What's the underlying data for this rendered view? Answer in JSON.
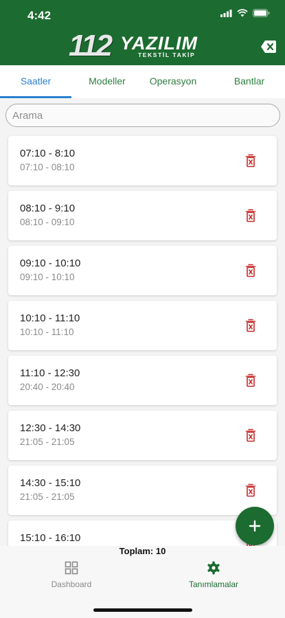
{
  "status_bar": {
    "time": "4:42"
  },
  "header": {
    "logo_number": "112",
    "logo_name": "YAZILIM",
    "logo_subtitle": "TEKSTİL TAKİP",
    "brand_color": "#1c6b30"
  },
  "tabs": [
    {
      "label": "Saatler",
      "active": true
    },
    {
      "label": "Modeller",
      "active": false
    },
    {
      "label": "Operasyon",
      "active": false
    },
    {
      "label": "Bantlar",
      "active": false
    }
  ],
  "search": {
    "placeholder": "Arama",
    "value": ""
  },
  "items": [
    {
      "title": "07:10 - 8:10",
      "subtitle": "07:10 - 08:10"
    },
    {
      "title": "08:10 - 9:10",
      "subtitle": "08:10 - 09:10"
    },
    {
      "title": "09:10 - 10:10",
      "subtitle": "09:10 - 10:10"
    },
    {
      "title": "10:10 - 11:10",
      "subtitle": "10:10 - 11:10"
    },
    {
      "title": "11:10 - 12:30",
      "subtitle": "20:40 - 20:40"
    },
    {
      "title": "12:30 - 14:30",
      "subtitle": "21:05 - 21:05"
    },
    {
      "title": "14:30 - 15:10",
      "subtitle": "21:05 - 21:05"
    },
    {
      "title": "15:10 - 16:10",
      "subtitle": ""
    }
  ],
  "footer": {
    "total": "Toplam: 10"
  },
  "bottom_nav": [
    {
      "label": "Dashboard",
      "icon": "dashboard-icon",
      "active": false
    },
    {
      "label": "Tanımlamalar",
      "icon": "settings-gear-icon",
      "active": true
    }
  ],
  "colors": {
    "accent": "#1c6b30",
    "delete": "#c62828",
    "tab_indicator": "#2a7fd1",
    "inactive": "#8a8a8a"
  }
}
